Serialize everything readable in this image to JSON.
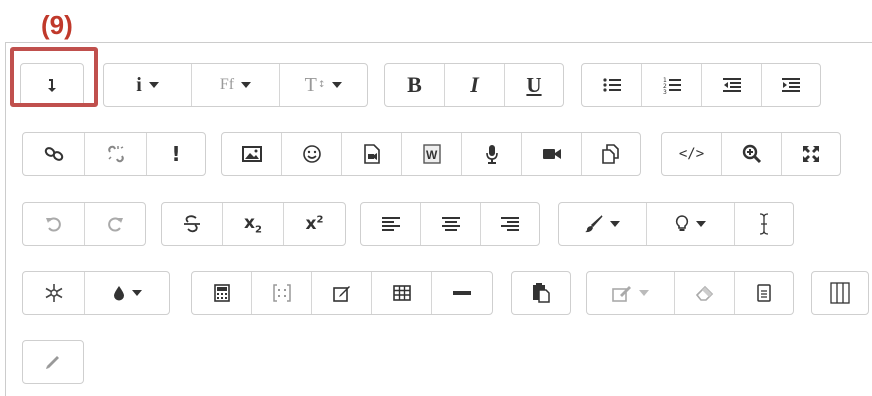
{
  "annotation": {
    "step_label": "(9)"
  },
  "toolbar": {
    "row1": {
      "toggle": "toolbar-toggle",
      "style_group": [
        "info",
        "font-family",
        "font-size"
      ],
      "format_group": [
        "B",
        "I",
        "U"
      ],
      "list_group": [
        "unordered-list",
        "ordered-list",
        "outdent",
        "indent"
      ]
    },
    "row2": {
      "link_group": [
        "link",
        "unlink",
        "exclamation"
      ],
      "media_group": [
        "image",
        "emoji",
        "media",
        "word-import",
        "record-audio",
        "record-video",
        "manage-files"
      ],
      "code_group": [
        "</>",
        "find",
        "fullscreen"
      ]
    },
    "row3": {
      "history_group": [
        "undo",
        "redo"
      ],
      "script_group": [
        "strikethrough",
        "subscript",
        "superscript"
      ],
      "align_group": [
        "align-left",
        "align-center",
        "align-right"
      ],
      "color_group": [
        "brush",
        "bulb",
        "cursor"
      ]
    },
    "row4": {
      "misc_group": [
        "snowflake",
        "drop"
      ],
      "table_group": [
        "calculator",
        "brackets",
        "edit",
        "table",
        "horizontal-rule"
      ],
      "paste_group": [
        "paste"
      ],
      "clean_group": [
        "clean-format",
        "eraser",
        "document"
      ],
      "columns_group": [
        "columns"
      ]
    },
    "row5": {
      "pencil_group": [
        "pencil"
      ]
    },
    "labels": {
      "bold": "B",
      "italic": "I",
      "underline": "U",
      "code": "</>",
      "subscript_base": "x",
      "subscript_index": "2",
      "superscript_base": "x",
      "superscript_index": "2",
      "font_family": "Ff",
      "font_size": "T",
      "info": "i"
    },
    "highlight_color": "#c0504d"
  }
}
